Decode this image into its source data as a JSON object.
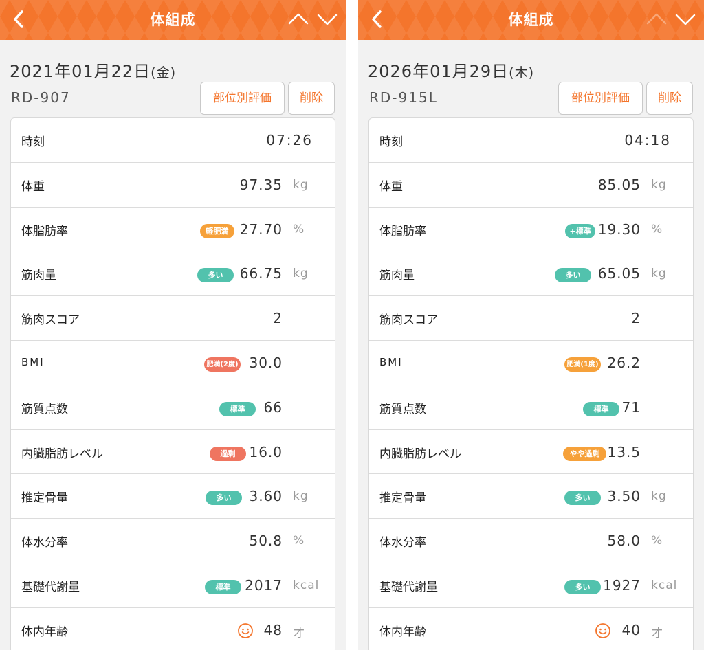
{
  "colors": {
    "accent": "#f4752c",
    "teal": "#52c2ad",
    "orange": "#f6a13a",
    "coral": "#ef7560"
  },
  "panels": [
    {
      "nav": {
        "title": "体組成",
        "up_enabled": true
      },
      "date_main": "2021年01月22日",
      "date_dow": "(金)",
      "model": "RD-907",
      "buttons": {
        "region_label": "部位別評価",
        "delete_label": "削除"
      },
      "rows": {
        "time": {
          "label": "時刻",
          "value": "07:26"
        },
        "weight": {
          "label": "体重",
          "value": "97.35",
          "unit": "kg"
        },
        "body_fat": {
          "label": "体脂肪率",
          "value": "27.70",
          "unit": "%",
          "badge": "軽肥満",
          "badge_color": "#f6a13a"
        },
        "muscle": {
          "label": "筋肉量",
          "value": "66.75",
          "unit": "kg",
          "badge": "多い",
          "badge_color": "#52c2ad"
        },
        "muscle_score": {
          "label": "筋肉スコア",
          "value": "2"
        },
        "bmi": {
          "label": "BMI",
          "value": "30.0",
          "badge": "肥満(2度)",
          "badge_color": "#ef7560"
        },
        "muscle_quality": {
          "label": "筋質点数",
          "value": "66",
          "badge": "標準",
          "badge_color": "#52c2ad"
        },
        "visceral_fat": {
          "label": "内臓脂肪レベル",
          "value": "16.0",
          "badge": "過剰",
          "badge_color": "#ef7560"
        },
        "bone": {
          "label": "推定骨量",
          "value": "3.60",
          "unit": "kg",
          "badge": "多い",
          "badge_color": "#52c2ad"
        },
        "water": {
          "label": "体水分率",
          "value": "50.8",
          "unit": "%"
        },
        "bmr": {
          "label": "基礎代謝量",
          "value": "2017",
          "unit": "kcal",
          "badge": "標準",
          "badge_color": "#52c2ad"
        },
        "body_age": {
          "label": "体内年齢",
          "value": "48",
          "unit": "才",
          "icon": "smile-face-icon"
        }
      }
    },
    {
      "nav": {
        "title": "体組成",
        "up_enabled": false
      },
      "date_main": "2026年01月29日",
      "date_dow": "(木)",
      "model": "RD-915L",
      "buttons": {
        "region_label": "部位別評価",
        "delete_label": "削除"
      },
      "rows": {
        "time": {
          "label": "時刻",
          "value": "04:18"
        },
        "weight": {
          "label": "体重",
          "value": "85.05",
          "unit": "kg"
        },
        "body_fat": {
          "label": "体脂肪率",
          "value": "19.30",
          "unit": "%",
          "badge": "+標準",
          "badge_color": "#52c2ad"
        },
        "muscle": {
          "label": "筋肉量",
          "value": "65.05",
          "unit": "kg",
          "badge": "多い",
          "badge_color": "#52c2ad"
        },
        "muscle_score": {
          "label": "筋肉スコア",
          "value": "2"
        },
        "bmi": {
          "label": "BMI",
          "value": "26.2",
          "badge": "肥満(1度)",
          "badge_color": "#f6a13a"
        },
        "muscle_quality": {
          "label": "筋質点数",
          "value": "71",
          "badge": "標準",
          "badge_color": "#52c2ad"
        },
        "visceral_fat": {
          "label": "内臓脂肪レベル",
          "value": "13.5",
          "badge": "やや過剰",
          "badge_color": "#f6a13a"
        },
        "bone": {
          "label": "推定骨量",
          "value": "3.50",
          "unit": "kg",
          "badge": "多い",
          "badge_color": "#52c2ad"
        },
        "water": {
          "label": "体水分率",
          "value": "58.0",
          "unit": "%"
        },
        "bmr": {
          "label": "基礎代謝量",
          "value": "1927",
          "unit": "kcal",
          "badge": "多い",
          "badge_color": "#52c2ad"
        },
        "body_age": {
          "label": "体内年齢",
          "value": "40",
          "unit": "才",
          "icon": "smile-face-icon"
        }
      }
    }
  ]
}
